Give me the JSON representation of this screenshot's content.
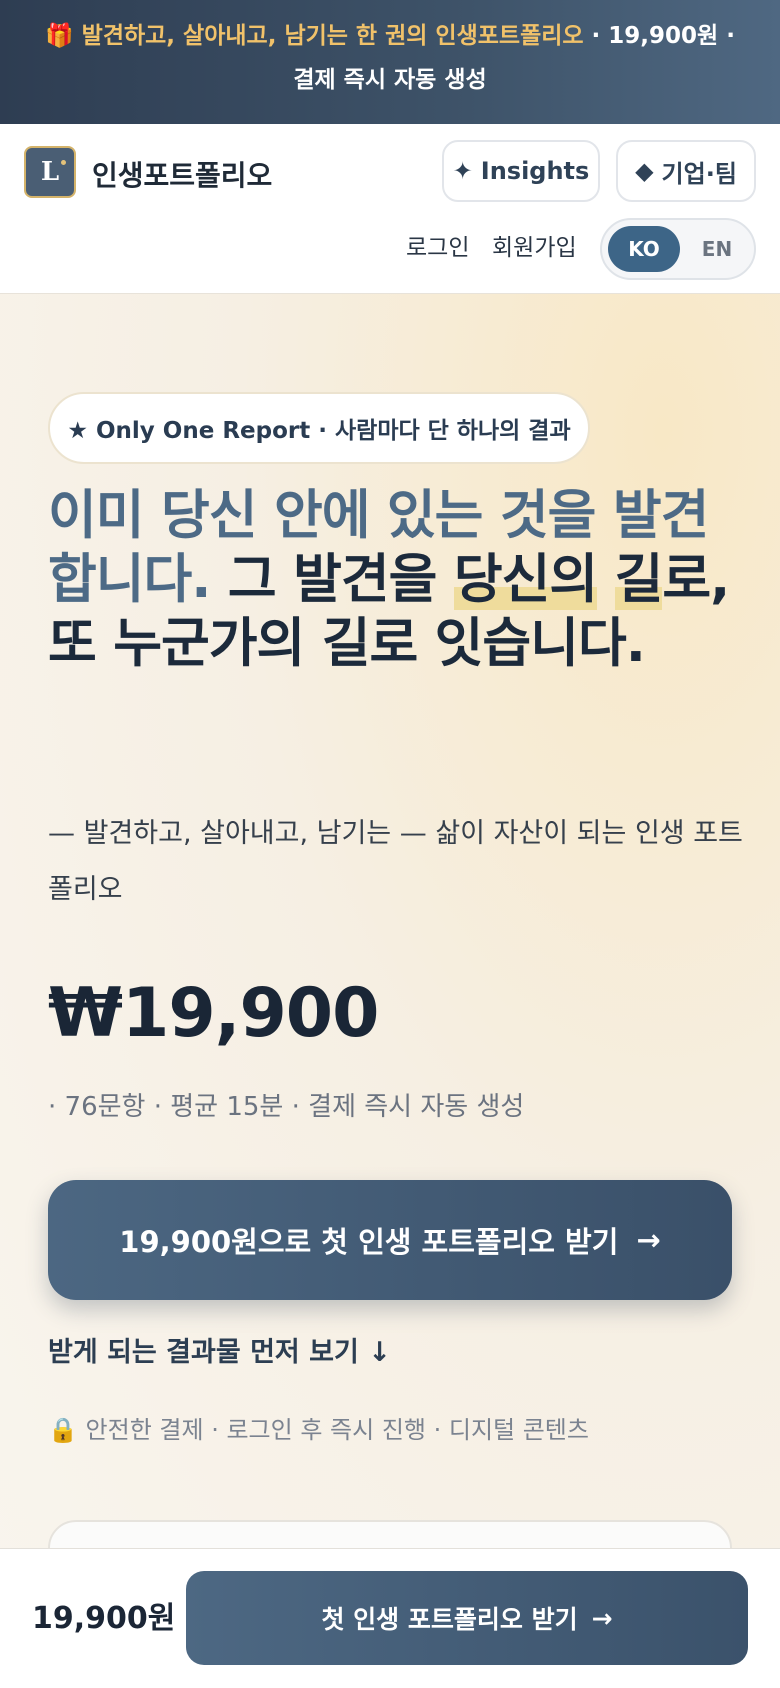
{
  "promo": {
    "gift_icon": "gift-icon",
    "highlight": "발견하고, 살아내고, 남기는 한 권의 인생포트폴리오",
    "price_text": " · 19,900원 ·",
    "line2": "결제 즉시 자동 생성"
  },
  "header": {
    "logo_letter": "L",
    "brand": "인생포트폴리오",
    "insights_icon": "✦",
    "insights_label": "Insights",
    "corp_icon": "◆",
    "corp_label": "기업·팀",
    "login": "로그인",
    "signup": "회원가입",
    "lang_ko": "KO",
    "lang_en": "EN",
    "lang_selected": "KO"
  },
  "hero": {
    "badge": "★ Only One Report · 사람마다 단 하나의 결과",
    "headline_muted": "이미 당신 안에 있는 것을 발견합니다.",
    "headline_part1": " 그 발견을 ",
    "headline_mark1": "당신의",
    "headline_mark2": "길",
    "headline_part2": "로, 또 누군가의 길로 잇습니다.",
    "subtitle": "— 발견하고, 살아내고, 남기는 — 삶이 자산이 되는 인생 포트폴리오",
    "price": "₩19,900",
    "meta": "· 76문항 · 평균 15분 · 결제 즉시 자동 생성",
    "cta_label": "19,900원으로 첫 인생 포트폴리오 받기",
    "cta_arrow": "→",
    "preview_label": "받게 되는 결과물 먼저 보기",
    "preview_arrow": "↓",
    "secure_icon": "🔒",
    "secure_text": "안전한 결제 · 로그인 후 즉시 진행 · 디지털 콘텐츠"
  },
  "bottom_bar": {
    "price": "19,900원",
    "cta_label": "첫 인생 포트폴리오 받기",
    "cta_arrow": "→"
  },
  "colors": {
    "accent": "#3d6587",
    "highlight_gold": "#f1c26a",
    "navy": "#2e3d52"
  }
}
